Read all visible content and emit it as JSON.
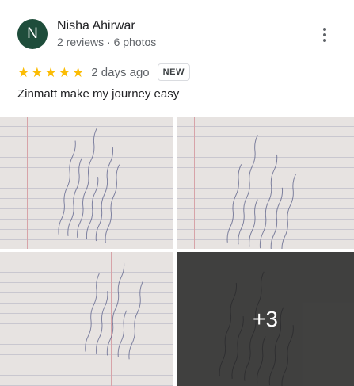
{
  "reviewer": {
    "avatar_letter": "N",
    "avatar_color": "#1e4d3b",
    "name": "Nisha Ahirwar",
    "stats": "2 reviews · 6 photos"
  },
  "review": {
    "rating": 5,
    "stars": [
      "★",
      "★",
      "★",
      "★",
      "★"
    ],
    "time": "2 days ago",
    "badge": "NEW",
    "text": "Zinmatt make my journey easy"
  },
  "photos": {
    "count_shown": 4,
    "more_label": "+3"
  },
  "icons": {
    "more": "more-vert-icon",
    "star": "star-icon"
  },
  "colors": {
    "star": "#fbbc04",
    "secondary_text": "#5f6368"
  }
}
